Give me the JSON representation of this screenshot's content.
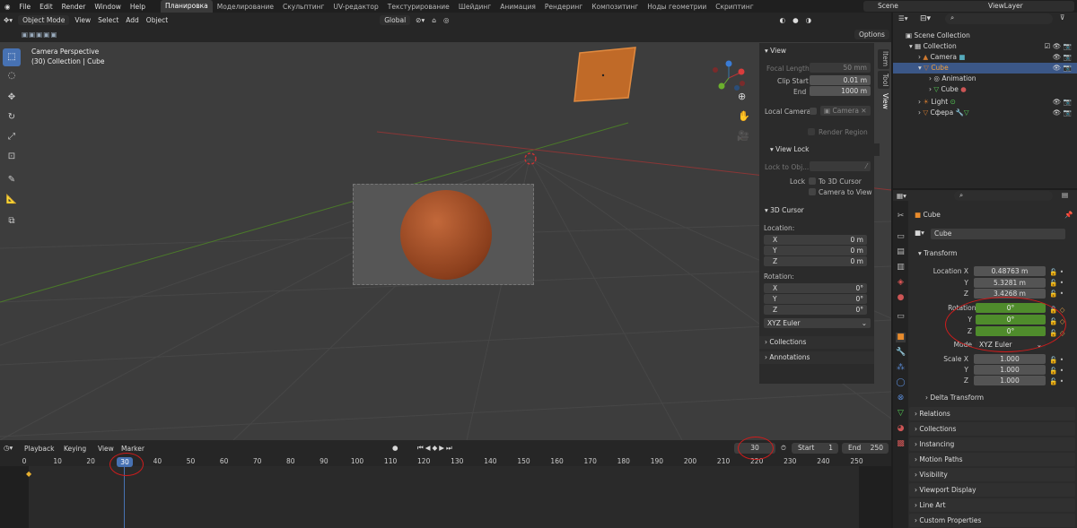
{
  "topbar": {
    "menus": [
      "File",
      "Edit",
      "Render",
      "Window",
      "Help"
    ],
    "workspaces": [
      "Планировка",
      "Моделирование",
      "Скульптинг",
      "UV-редактор",
      "Текстурирование",
      "Шейдинг",
      "Анимация",
      "Рендеринг",
      "Композитинг",
      "Ноды геометрии",
      "Скриптинг"
    ],
    "scene": "Scene",
    "view_layer": "ViewLayer"
  },
  "viewport_header": {
    "mode": "Object Mode",
    "menus": [
      "View",
      "Select",
      "Add",
      "Object"
    ],
    "orientation": "Global",
    "options": "Options"
  },
  "viewport": {
    "camera_label": "Camera Perspective",
    "object_label": "(30) Collection | Cube"
  },
  "npanel": {
    "view_title": "View",
    "focal_label": "Focal Length",
    "focal": "50 mm",
    "clip_start_label": "Clip Start",
    "clip_start": "0.01 m",
    "end_label": "End",
    "clip_end": "1000 m",
    "local_camera_label": "Local Camera",
    "local_camera": "Camera",
    "render_region": "Render Region",
    "view_lock_title": "View Lock",
    "lock_obj_label": "Lock to Obj...",
    "lock_label": "Lock",
    "to_3d_cursor": "To 3D Cursor",
    "camera_to_view": "Camera to View",
    "cursor_title": "3D Cursor",
    "location_label": "Location:",
    "rotation_label": "Rotation:",
    "loc": [
      {
        "a": "X",
        "v": "0 m"
      },
      {
        "a": "Y",
        "v": "0 m"
      },
      {
        "a": "Z",
        "v": "0 m"
      }
    ],
    "rot": [
      {
        "a": "X",
        "v": "0°"
      },
      {
        "a": "Y",
        "v": "0°"
      },
      {
        "a": "Z",
        "v": "0°"
      }
    ],
    "rot_mode": "XYZ Euler",
    "collections": "Collections",
    "annotations": "Annotations",
    "tabs": [
      "Item",
      "Tool",
      "View"
    ]
  },
  "outliner": {
    "rows": [
      "Scene Collection",
      "Collection",
      "Camera",
      "Cube",
      "Animation",
      "Cube",
      "Light",
      "Сфера"
    ]
  },
  "properties": {
    "object_name": "Cube",
    "data_name": "Cube",
    "transform": "Transform",
    "location_label": "Location X",
    "loc": [
      "0.48763 m",
      "5.3281 m",
      "3.4268 m"
    ],
    "rotation_label": "Rotation X",
    "rot": [
      "0°",
      "0°",
      "0°"
    ],
    "mode_label": "Mode",
    "mode": "XYZ Euler",
    "scale_label": "Scale X",
    "scale": [
      "1.000",
      "1.000",
      "1.000"
    ],
    "axis_y": "Y",
    "axis_z": "Z",
    "sections": [
      "Delta Transform",
      "Relations",
      "Collections",
      "Instancing",
      "Motion Paths",
      "Visibility",
      "Viewport Display",
      "Line Art",
      "Custom Properties"
    ]
  },
  "timeline": {
    "menus": [
      "Playback",
      "Keying",
      "View",
      "Marker"
    ],
    "current_frame": "30",
    "start_label": "Start",
    "start": "1",
    "end_label": "End",
    "end": "250",
    "ticks": [
      "0",
      "10",
      "20",
      "30",
      "40",
      "50",
      "60",
      "70",
      "80",
      "90",
      "100",
      "110",
      "120",
      "130",
      "140",
      "150",
      "160",
      "170",
      "180",
      "190",
      "200",
      "210",
      "220",
      "230",
      "240",
      "250"
    ]
  },
  "colors": {
    "accent": "#4772b3",
    "keyframed": "#4f8c2c",
    "annotation": "#d01c1c",
    "object": "#c06a28"
  }
}
